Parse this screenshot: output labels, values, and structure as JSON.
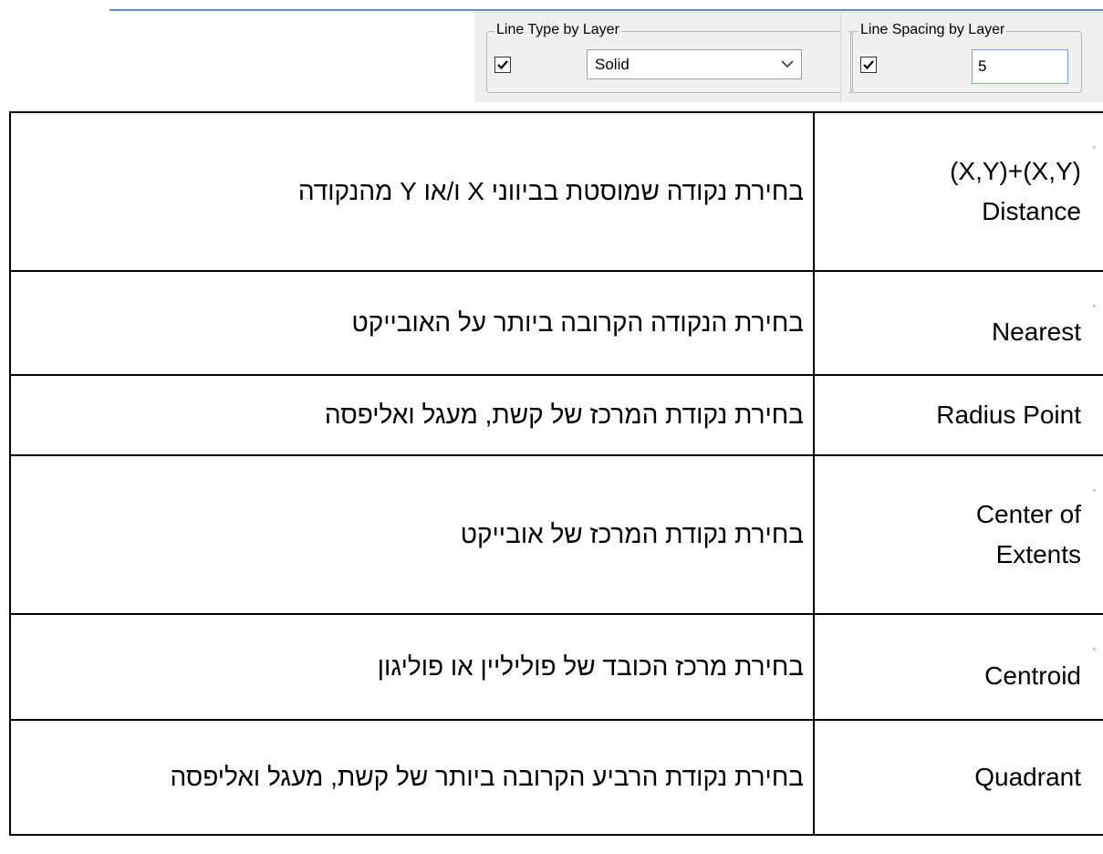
{
  "toolbar": {
    "line_type_group": {
      "label": "Line Type by Layer",
      "checked": true,
      "selected": "Solid"
    },
    "line_spacing_group": {
      "label": "Line Spacing by Layer",
      "checked": true,
      "value": "5"
    }
  },
  "table": {
    "rows": [
      {
        "name": "(X,Y)+(X,Y)\nDistance",
        "description": "בחירת נקודה שמוסטת בביווני X ו/או Y מהנקודה"
      },
      {
        "name": "Nearest",
        "description": "בחירת הנקודה הקרובה ביותר על האובייקט"
      },
      {
        "name": "Radius Point",
        "description": "בחירת נקודת המרכז של קשת, מעגל ואליפסה"
      },
      {
        "name": "Center of\nExtents",
        "description": "בחירת נקודת המרכז של אובייקט"
      },
      {
        "name": "Centroid",
        "description": "בחירת מרכז הכובד של פוליליין או פוליגון"
      },
      {
        "name": "Quadrant",
        "description": "בחירת נקודת הרביע הקרובה ביותר של קשת, מעגל ואליפסה"
      }
    ]
  }
}
